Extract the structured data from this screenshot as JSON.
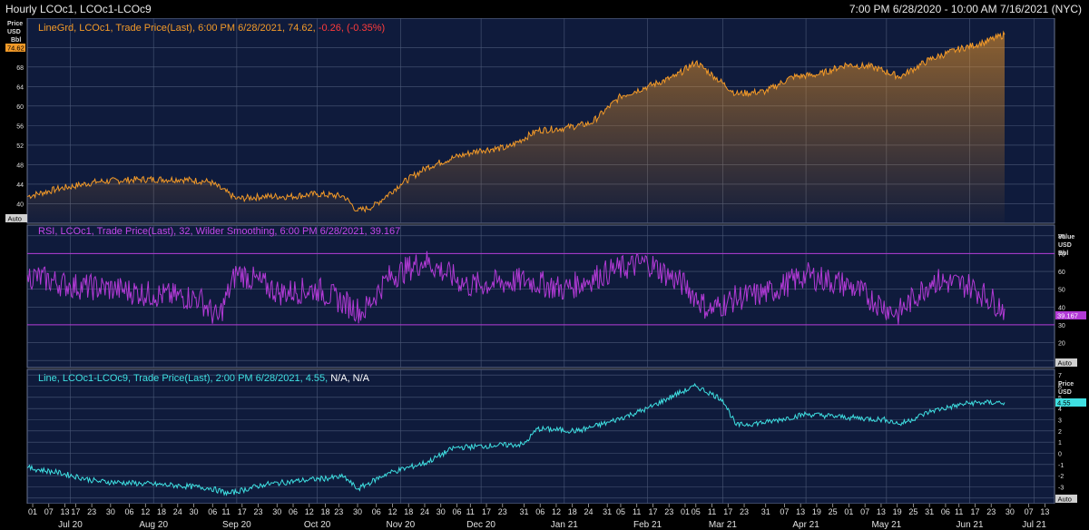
{
  "header": {
    "left_title": "Hourly LCOc1, LCOc1-LCOc9",
    "right_range": "7:00 PM 6/28/2020 - 10:00 AM 7/16/2021 (NYC)"
  },
  "panels": {
    "price": {
      "legend_main": "LineGrd, LCOc1, Trade Price(Last), 6:00 PM 6/28/2021, 74.62, ",
      "legend_change": "-0.26, (-0.35%)",
      "unit_lines": [
        "Price",
        "USD",
        "Bbl"
      ],
      "last_value": "74.62",
      "auto_label": "Auto"
    },
    "rsi": {
      "legend": "RSI, LCOc1, Trade Price(Last),  32, Wilder Smoothing, 6:00 PM 6/28/2021, 39.167",
      "unit_lines": [
        "Value",
        "USD",
        "Bbl"
      ],
      "last_value": "39.167",
      "auto_label": "Auto"
    },
    "spread": {
      "legend_main": "Line, LCOc1-LCOc9, Trade Price(Last), 2:00 PM 6/28/2021, 4.55, ",
      "legend_na": "N/A, N/A",
      "unit_lines": [
        "Price",
        "USD"
      ],
      "last_value": "4.55",
      "auto_label": "Auto"
    }
  },
  "colors": {
    "background": "#000000",
    "panel_bg": "#0f1b3c",
    "grid": "#4b5877",
    "price_line": "#f39a28",
    "rsi_line": "#b23ad6",
    "spread_line": "#3fe0e2",
    "change_negative": "#ff3b3b"
  },
  "chart_data": [
    {
      "type": "area",
      "title": "LCOc1, Trade Price(Last)",
      "ylabel": "Price USD Bbl",
      "ylim": [
        36,
        78
      ],
      "yticks": [
        40,
        44,
        48,
        52,
        56,
        60,
        64,
        68,
        72
      ],
      "x": [
        "2020-06-29",
        "2020-07-10",
        "2020-07-25",
        "2020-08-10",
        "2020-08-25",
        "2020-09-05",
        "2020-09-15",
        "2020-09-25",
        "2020-10-05",
        "2020-10-15",
        "2020-10-25",
        "2020-10-30",
        "2020-11-05",
        "2020-11-15",
        "2020-11-25",
        "2020-12-05",
        "2020-12-15",
        "2020-12-25",
        "2021-01-05",
        "2021-01-15",
        "2021-01-25",
        "2021-02-05",
        "2021-02-15",
        "2021-02-25",
        "2021-03-05",
        "2021-03-12",
        "2021-03-20",
        "2021-03-31",
        "2021-04-10",
        "2021-04-20",
        "2021-04-30",
        "2021-05-10",
        "2021-05-20",
        "2021-05-31",
        "2021-06-10",
        "2021-06-20",
        "2021-06-28"
      ],
      "series": [
        {
          "values": [
            41.5,
            43.0,
            44.5,
            45.0,
            45.0,
            44.5,
            41.0,
            41.5,
            41.5,
            42.0,
            41.5,
            38.5,
            39.5,
            44.0,
            47.5,
            49.5,
            51.0,
            51.5,
            55.0,
            55.5,
            56.5,
            62.0,
            64.0,
            66.0,
            69.0,
            66.0,
            62.5,
            63.0,
            66.0,
            66.5,
            68.5,
            68.0,
            66.0,
            69.5,
            71.5,
            73.0,
            74.62
          ]
        }
      ],
      "grid": true
    },
    {
      "type": "line",
      "title": "RSI, LCOc1, 32, Wilder Smoothing",
      "ylabel": "Value USD Bbl",
      "ylim": [
        6,
        86
      ],
      "yticks": [
        10,
        20,
        30,
        40,
        50,
        60,
        70,
        80
      ],
      "reference_lines": [
        30,
        70
      ],
      "x": [
        "2020-06-29",
        "2020-07-15",
        "2020-08-01",
        "2020-08-15",
        "2020-09-01",
        "2020-09-08",
        "2020-09-15",
        "2020-10-01",
        "2020-10-15",
        "2020-11-01",
        "2020-11-10",
        "2020-11-24",
        "2020-12-10",
        "2021-01-01",
        "2021-01-15",
        "2021-02-01",
        "2021-02-15",
        "2021-03-01",
        "2021-03-10",
        "2021-03-20",
        "2021-04-01",
        "2021-04-15",
        "2021-05-01",
        "2021-05-19",
        "2021-06-01",
        "2021-06-15",
        "2021-06-28"
      ],
      "series": [
        {
          "values": [
            58,
            52,
            50,
            47,
            45,
            33,
            60,
            48,
            50,
            37,
            56,
            66,
            52,
            55,
            50,
            60,
            65,
            52,
            38,
            45,
            48,
            58,
            52,
            36,
            55,
            52,
            39.167
          ]
        }
      ],
      "grid": true
    },
    {
      "type": "line",
      "title": "LCOc1-LCOc9, Trade Price(Last)",
      "ylabel": "Price USD",
      "ylim": [
        -4.5,
        7.5
      ],
      "yticks": [
        -4,
        -3,
        -2,
        -1,
        0,
        1,
        2,
        3,
        4,
        5,
        6,
        7
      ],
      "x": [
        "2020-06-29",
        "2020-07-10",
        "2020-07-25",
        "2020-08-10",
        "2020-08-25",
        "2020-09-05",
        "2020-09-12",
        "2020-09-25",
        "2020-10-10",
        "2020-10-25",
        "2020-10-30",
        "2020-11-10",
        "2020-11-25",
        "2020-12-05",
        "2020-12-20",
        "2020-12-31",
        "2021-01-05",
        "2021-01-20",
        "2021-02-01",
        "2021-02-15",
        "2021-02-25",
        "2021-03-05",
        "2021-03-15",
        "2021-03-20",
        "2021-04-01",
        "2021-04-15",
        "2021-05-01",
        "2021-05-15",
        "2021-05-20",
        "2021-06-01",
        "2021-06-15",
        "2021-06-28"
      ],
      "series": [
        {
          "values": [
            -1.3,
            -1.7,
            -2.5,
            -2.7,
            -2.9,
            -3.1,
            -3.6,
            -2.8,
            -2.4,
            -2.1,
            -3.2,
            -1.8,
            -0.8,
            0.5,
            0.7,
            0.8,
            2.2,
            2.0,
            2.8,
            4.0,
            5.2,
            6.0,
            4.8,
            2.5,
            2.8,
            3.5,
            3.2,
            3.0,
            2.6,
            3.8,
            4.5,
            4.55
          ]
        }
      ],
      "grid": true
    }
  ],
  "time_axis": {
    "day_ticks": [
      {
        "d": "01",
        "date": "2020-07-01"
      },
      {
        "d": "07",
        "date": "2020-07-07"
      },
      {
        "d": "13",
        "date": "2020-07-13"
      },
      {
        "d": "17",
        "date": "2020-07-17"
      },
      {
        "d": "23",
        "date": "2020-07-23"
      },
      {
        "d": "30",
        "date": "2020-07-30"
      },
      {
        "d": "06",
        "date": "2020-08-06"
      },
      {
        "d": "12",
        "date": "2020-08-12"
      },
      {
        "d": "18",
        "date": "2020-08-18"
      },
      {
        "d": "24",
        "date": "2020-08-24"
      },
      {
        "d": "30",
        "date": "2020-08-30"
      },
      {
        "d": "06",
        "date": "2020-09-06"
      },
      {
        "d": "11",
        "date": "2020-09-11"
      },
      {
        "d": "17",
        "date": "2020-09-17"
      },
      {
        "d": "23",
        "date": "2020-09-23"
      },
      {
        "d": "30",
        "date": "2020-09-30"
      },
      {
        "d": "06",
        "date": "2020-10-06"
      },
      {
        "d": "12",
        "date": "2020-10-12"
      },
      {
        "d": "18",
        "date": "2020-10-18"
      },
      {
        "d": "23",
        "date": "2020-10-23"
      },
      {
        "d": "30",
        "date": "2020-10-30"
      },
      {
        "d": "06",
        "date": "2020-11-06"
      },
      {
        "d": "12",
        "date": "2020-11-12"
      },
      {
        "d": "18",
        "date": "2020-11-18"
      },
      {
        "d": "24",
        "date": "2020-11-24"
      },
      {
        "d": "30",
        "date": "2020-11-30"
      },
      {
        "d": "06",
        "date": "2020-12-06"
      },
      {
        "d": "11",
        "date": "2020-12-11"
      },
      {
        "d": "17",
        "date": "2020-12-17"
      },
      {
        "d": "23",
        "date": "2020-12-23"
      },
      {
        "d": "31",
        "date": "2020-12-31"
      },
      {
        "d": "06",
        "date": "2021-01-06"
      },
      {
        "d": "12",
        "date": "2021-01-12"
      },
      {
        "d": "18",
        "date": "2021-01-18"
      },
      {
        "d": "24",
        "date": "2021-01-24"
      },
      {
        "d": "31",
        "date": "2021-01-31"
      },
      {
        "d": "05",
        "date": "2021-02-05"
      },
      {
        "d": "11",
        "date": "2021-02-11"
      },
      {
        "d": "17",
        "date": "2021-02-17"
      },
      {
        "d": "23",
        "date": "2021-02-23"
      },
      {
        "d": "01",
        "date": "2021-03-01"
      },
      {
        "d": "05",
        "date": "2021-03-05"
      },
      {
        "d": "11",
        "date": "2021-03-11"
      },
      {
        "d": "17",
        "date": "2021-03-17"
      },
      {
        "d": "23",
        "date": "2021-03-23"
      },
      {
        "d": "31",
        "date": "2021-03-31"
      },
      {
        "d": "07",
        "date": "2021-04-07"
      },
      {
        "d": "13",
        "date": "2021-04-13"
      },
      {
        "d": "19",
        "date": "2021-04-19"
      },
      {
        "d": "25",
        "date": "2021-04-25"
      },
      {
        "d": "01",
        "date": "2021-05-01"
      },
      {
        "d": "07",
        "date": "2021-05-07"
      },
      {
        "d": "13",
        "date": "2021-05-13"
      },
      {
        "d": "19",
        "date": "2021-05-19"
      },
      {
        "d": "25",
        "date": "2021-05-25"
      },
      {
        "d": "31",
        "date": "2021-05-31"
      },
      {
        "d": "06",
        "date": "2021-06-06"
      },
      {
        "d": "11",
        "date": "2021-06-11"
      },
      {
        "d": "17",
        "date": "2021-06-17"
      },
      {
        "d": "23",
        "date": "2021-06-23"
      },
      {
        "d": "30",
        "date": "2021-06-30"
      },
      {
        "d": "07",
        "date": "2021-07-07"
      },
      {
        "d": "13",
        "date": "2021-07-13"
      }
    ],
    "month_labels": [
      {
        "label": "Jul 20",
        "date": "2020-07-15"
      },
      {
        "label": "Aug 20",
        "date": "2020-08-15"
      },
      {
        "label": "Sep 20",
        "date": "2020-09-15"
      },
      {
        "label": "Oct 20",
        "date": "2020-10-15"
      },
      {
        "label": "Nov 20",
        "date": "2020-11-15"
      },
      {
        "label": "Dec 20",
        "date": "2020-12-15"
      },
      {
        "label": "Jan 21",
        "date": "2021-01-15"
      },
      {
        "label": "Feb 21",
        "date": "2021-02-15"
      },
      {
        "label": "Mar 21",
        "date": "2021-03-15"
      },
      {
        "label": "Apr 21",
        "date": "2021-04-15"
      },
      {
        "label": "May 21",
        "date": "2021-05-15"
      },
      {
        "label": "Jun 21",
        "date": "2021-06-15"
      },
      {
        "label": "Jul 21",
        "date": "2021-07-09"
      }
    ]
  }
}
